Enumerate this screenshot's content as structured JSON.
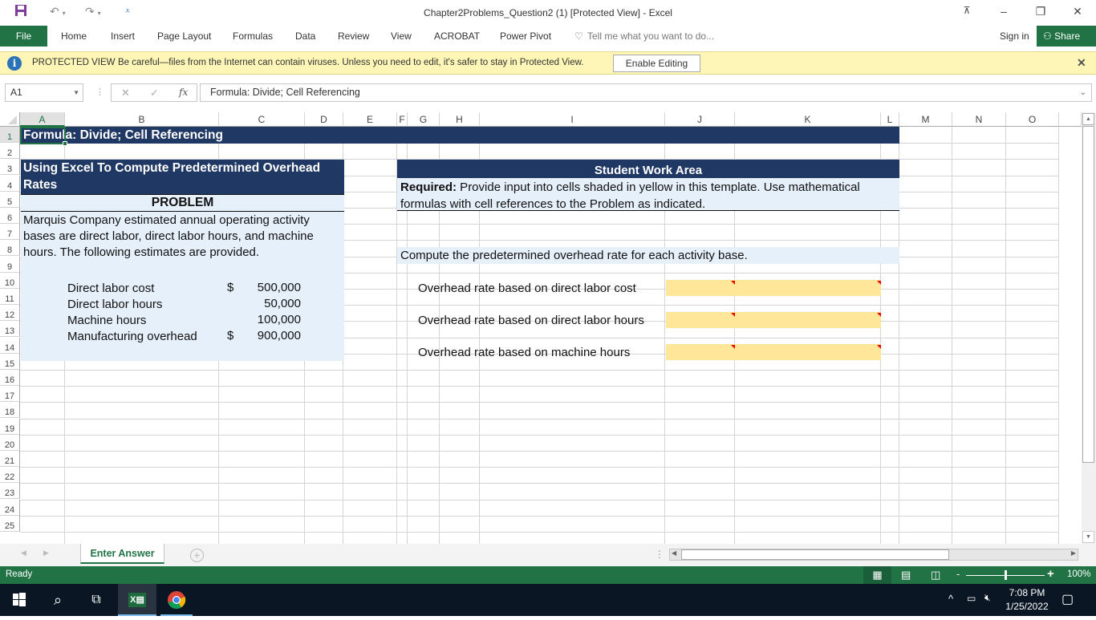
{
  "window": {
    "title": "Chapter2Problems_Question2 (1)  [Protected View] - Excel"
  },
  "ribbon": {
    "file": "File",
    "tabs": [
      "Home",
      "Insert",
      "Page Layout",
      "Formulas",
      "Data",
      "Review",
      "View",
      "ACROBAT",
      "Power Pivot"
    ],
    "tell_me": "Tell me what you want to do...",
    "sign_in": "Sign in",
    "share": "Share"
  },
  "protected_view": {
    "label": "PROTECTED VIEW",
    "message": "Be careful—files from the Internet can contain viruses. Unless you need to edit, it's safer to stay in Protected View.",
    "enable_button": "Enable Editing"
  },
  "formula_bar": {
    "name_box": "A1",
    "fx": "fx",
    "value": "Formula: Divide; Cell Referencing"
  },
  "columns": [
    "A",
    "B",
    "C",
    "D",
    "E",
    "F",
    "G",
    "H",
    "I",
    "J",
    "K",
    "L",
    "M",
    "N",
    "O"
  ],
  "rows": [
    "1",
    "2",
    "3",
    "4",
    "5",
    "6",
    "7",
    "8",
    "9",
    "10",
    "11",
    "12",
    "13",
    "14",
    "15",
    "16",
    "17",
    "18",
    "19",
    "20",
    "21",
    "22",
    "23",
    "24",
    "25"
  ],
  "sheet": {
    "title_row": "Formula: Divide; Cell Referencing",
    "left_header_line1": "Using Excel To Compute Predetermined Overhead",
    "left_header_line2": "Rates",
    "problem_label": "PROBLEM",
    "problem_text": [
      "Marquis Company estimated annual operating activity",
      "bases are direct labor, direct labor hours, and machine",
      "hours. The following estimates are provided."
    ],
    "estimates": [
      {
        "label": "Direct labor cost",
        "currency": "$",
        "value": "500,000"
      },
      {
        "label": "Direct labor hours",
        "currency": "",
        "value": "50,000"
      },
      {
        "label": "Machine hours",
        "currency": "",
        "value": "100,000"
      },
      {
        "label": "Manufacturing overhead",
        "currency": "$",
        "value": "900,000"
      }
    ],
    "work_area_header": "Student Work Area",
    "required_label": "Required:",
    "required_text_line1": " Provide input into cells shaded in yellow in this template. Use mathematical",
    "required_text_line2": "formulas with cell references to the Problem as indicated.",
    "compute_instruction": "Compute the predetermined overhead rate for each activity base.",
    "answers": [
      {
        "label": "Overhead rate based on direct labor cost",
        "value": ""
      },
      {
        "label": "Overhead rate based on direct labor hours",
        "value": ""
      },
      {
        "label": "Overhead rate based on machine hours",
        "value": ""
      }
    ]
  },
  "sheet_tabs": {
    "active": "Enter Answer"
  },
  "status": {
    "text": "Ready",
    "zoom": "100%",
    "zoom_level_percent": 100
  },
  "taskbar": {
    "time": "7:08 PM",
    "date": "1/25/2022"
  },
  "colors": {
    "excel_green": "#217346",
    "header_navy": "#203864",
    "problem_blue": "#e6f0fa",
    "input_yellow": "#ffe699",
    "pv_yellow": "#fdf6b6"
  }
}
